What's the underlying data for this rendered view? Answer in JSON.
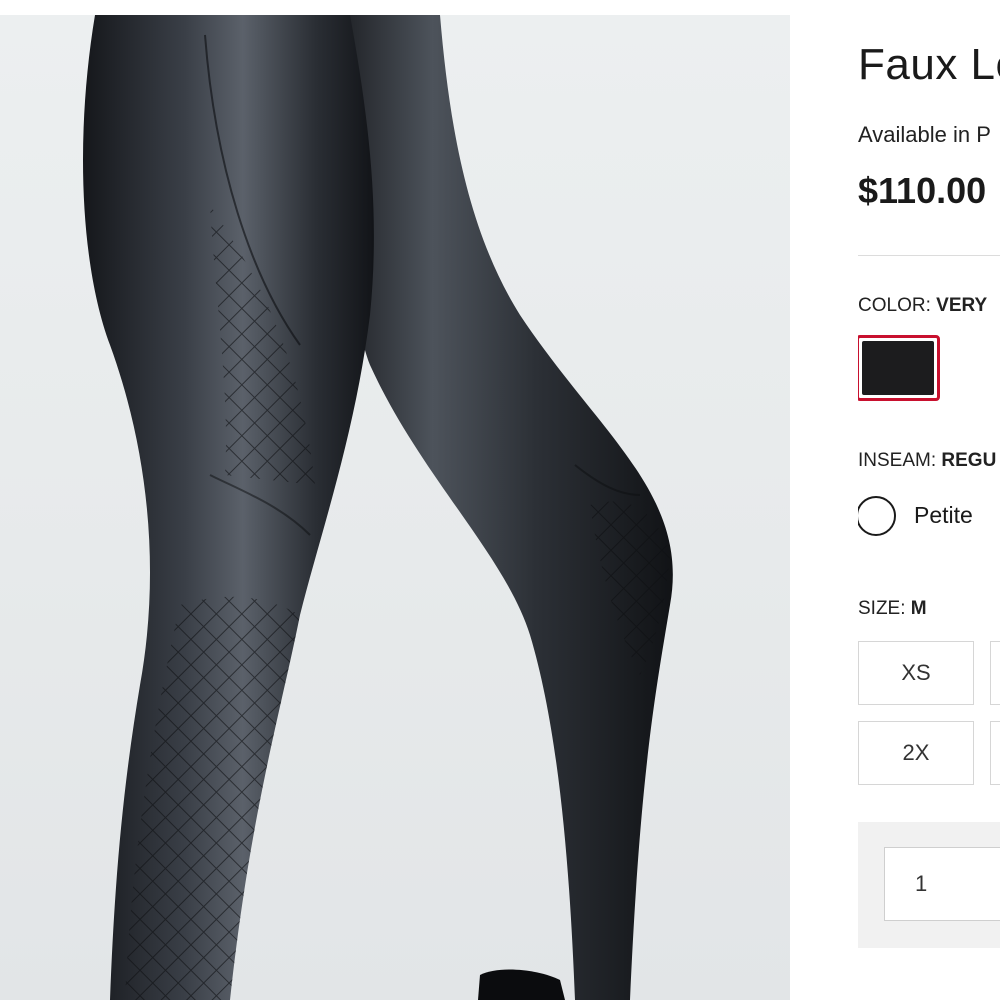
{
  "product": {
    "title": "Faux Le",
    "availability": "Available in P",
    "price": "$110.00"
  },
  "color": {
    "label": "COLOR:",
    "value": "VERY",
    "swatch_hex": "#1c1c1e",
    "selected_border_hex": "#c8102e"
  },
  "inseam": {
    "label": "INSEAM:",
    "value": "REGU",
    "options": [
      {
        "label": "Petite",
        "selected": false
      }
    ]
  },
  "size": {
    "label": "SIZE:",
    "value": "M",
    "options": [
      "XS",
      "2X"
    ]
  },
  "quantity": {
    "value": "1"
  },
  "image": {
    "alt_subject": "model-wearing-black-faux-leather-quilted-leggings"
  }
}
